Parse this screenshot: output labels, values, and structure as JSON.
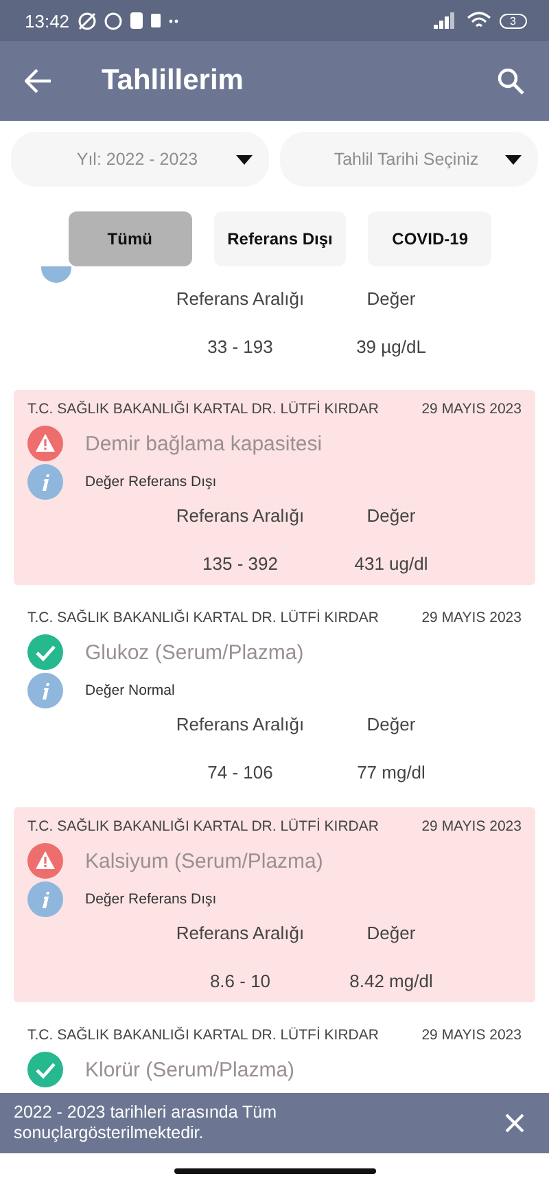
{
  "status_bar": {
    "time": "13:42",
    "battery": "3"
  },
  "header": {
    "title": "Tahlillerim"
  },
  "filters": [
    {
      "placeholder": "Yıl: 2022 - 2023"
    },
    {
      "placeholder": "Tahlil Tarihi Seçiniz"
    }
  ],
  "chips": [
    {
      "label": "Tümü",
      "selected": true
    },
    {
      "label": "Referans Dışı",
      "selected": false
    },
    {
      "label": "COVID-19",
      "selected": false
    }
  ],
  "results": [
    {
      "kind": "normal",
      "range_label": "Referans Aralığı",
      "value_label": "Değer",
      "range": "33 - 193",
      "value": "39 µg/dL"
    },
    {
      "kind": "out",
      "hospital": "T.C. SAĞLIK BAKANLIĞI KARTAL DR. LÜTFİ KIRDAR",
      "date": "29 MAYIS 2023",
      "name": "Demir bağlama kapasitesi",
      "note": "Değer Referans Dışı",
      "range_label": "Referans Aralığı",
      "value_label": "Değer",
      "range": "135 - 392",
      "value": "431 ug/dl"
    },
    {
      "kind": "normal",
      "hospital": "T.C. SAĞLIK BAKANLIĞI KARTAL DR. LÜTFİ KIRDAR",
      "date": "29 MAYIS 2023",
      "name": "Glukoz (Serum/Plazma)",
      "note": "Değer Normal",
      "range_label": "Referans Aralığı",
      "value_label": "Değer",
      "range": "74 - 106",
      "value": "77 mg/dl"
    },
    {
      "kind": "out",
      "hospital": "T.C. SAĞLIK BAKANLIĞI KARTAL DR. LÜTFİ KIRDAR",
      "date": "29 MAYIS 2023",
      "name": "Kalsiyum (Serum/Plazma)",
      "note": "Değer Referans Dışı",
      "range_label": "Referans Aralığı",
      "value_label": "Değer",
      "range": "8.6 - 10",
      "value": "8.42 mg/dl"
    },
    {
      "kind": "normal",
      "hospital": "T.C. SAĞLIK BAKANLIĞI KARTAL DR. LÜTFİ KIRDAR",
      "date": "29 MAYIS 2023",
      "name": "Klorür (Serum/Plazma)"
    }
  ],
  "snackbar": {
    "message": "2022 - 2023 tarihleri arasında Tüm sonuçlargösterilmektedir."
  }
}
